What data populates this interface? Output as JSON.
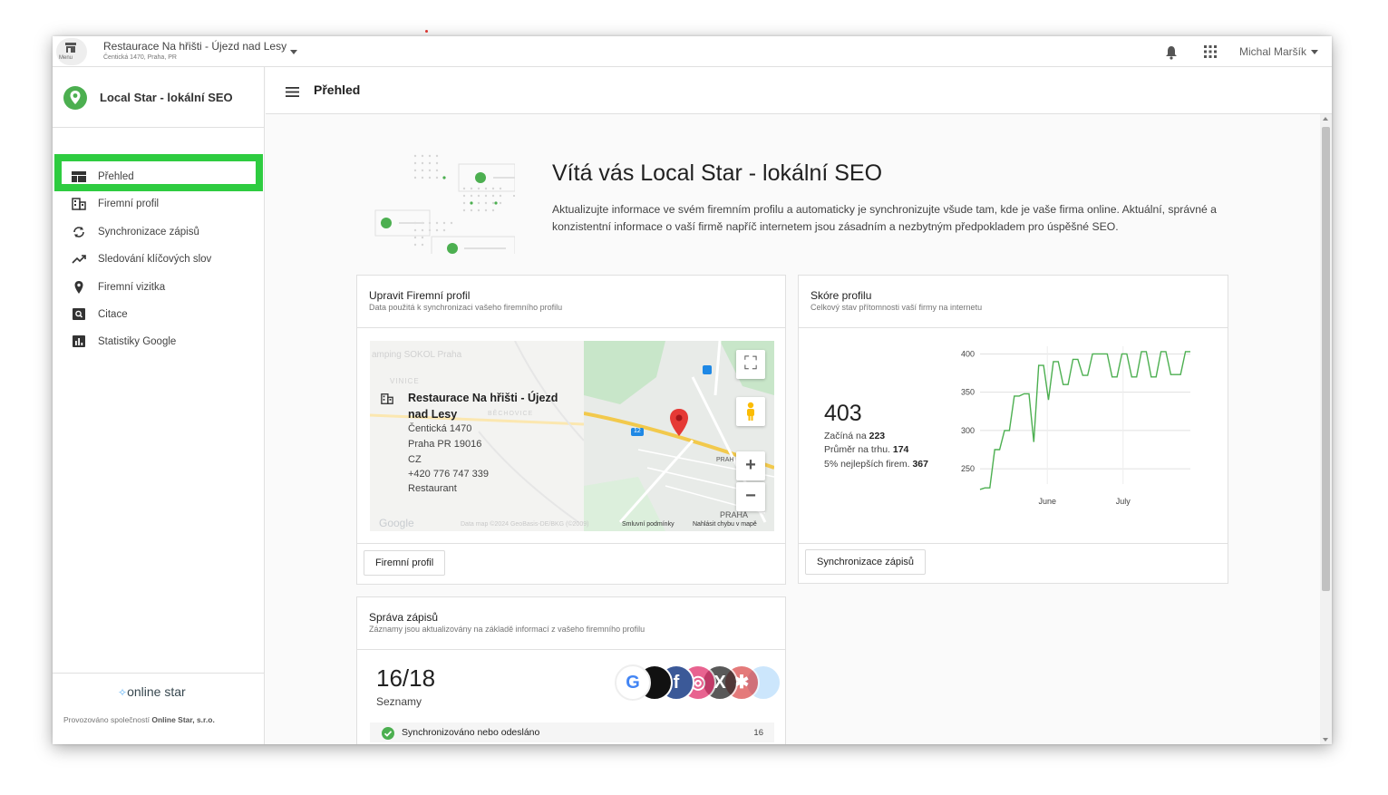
{
  "topbar": {
    "menu_label": "Menu",
    "business_name": "Restaurace Na hřišti - Újezd nad Lesy",
    "business_address": "Čentická 1470, Praha, PR",
    "user_name": "Michal Maršík"
  },
  "sidebar": {
    "brand_title": "Local Star - lokální SEO",
    "items": [
      {
        "label": "Přehled",
        "icon": "dashboard-icon"
      },
      {
        "label": "Firemní profil",
        "icon": "building-icon"
      },
      {
        "label": "Synchronizace zápisů",
        "icon": "sync-icon"
      },
      {
        "label": "Sledování klíčových slov",
        "icon": "trending-up-icon"
      },
      {
        "label": "Firemní vizitka",
        "icon": "location-pin-icon"
      },
      {
        "label": "Citace",
        "icon": "search-box-icon"
      },
      {
        "label": "Statistiky Google",
        "icon": "bar-chart-icon"
      }
    ],
    "footer_logo": "online star",
    "footer_text_prefix": "Provozováno společností",
    "footer_company": "Online Star, s.r.o."
  },
  "header": {
    "title": "Přehled"
  },
  "welcome": {
    "title": "Vítá vás Local Star - lokální SEO",
    "text": "Aktualizujte informace ve svém firemním profilu a automaticky je synchronizujte všude tam, kde je vaše firma online. Aktuální, správné a konzistentní informace o vaší firmě napříč internetem jsou zásadním a nezbytným předpokladem pro úspěšné SEO."
  },
  "profile_card": {
    "title": "Upravit Firemní profil",
    "subtitle": "Data použitá k synchronizaci vašeho firemního profilu",
    "business": {
      "name": "Restaurace Na hřišti - Újezd nad Lesy",
      "street": "Čentická 1470",
      "city": "Praha PR 19016",
      "country": "CZ",
      "phone": "+420 776 747 339",
      "category": "Restaurant"
    },
    "map": {
      "faded_label_1": "amping SOKOL Praha",
      "faded_label_2": "VINICE",
      "faded_label_3": "BĚCHOVICE",
      "road_badge": "12",
      "area_label": "PRAH",
      "area_label_2": "PRAHA",
      "google_logo": "Google",
      "map_data": "Data map ©2024 GeoBasis-DE/BKG (©2009)",
      "terms": "Smluvní podmínky",
      "report": "Nahlásit chybu v mapě"
    },
    "button": "Firemní profil"
  },
  "score_card": {
    "title": "Skóre profilu",
    "subtitle": "Celkový stav přítomnosti vaší firmy na internetu",
    "score": "403",
    "start_label": "Začíná na",
    "start_value": "223",
    "avg_label": "Průměr na trhu.",
    "avg_value": "174",
    "top_label": "5% nejlepších firem.",
    "top_value": "367",
    "button": "Synchronizace zápisů"
  },
  "chart_data": {
    "type": "line",
    "title": "",
    "xlabel": "",
    "ylabel": "",
    "ylim": [
      230,
      410
    ],
    "yticks": [
      250,
      300,
      350,
      400
    ],
    "xticks": [
      "June",
      "July"
    ],
    "grid": true,
    "color": "#4caf50",
    "series": [
      {
        "values": [
          223,
          225,
          225,
          275,
          275,
          300,
          300,
          345,
          345,
          348,
          348,
          285,
          385,
          385,
          340,
          390,
          390,
          360,
          360,
          393,
          393,
          372,
          372,
          400,
          400,
          400,
          400,
          370,
          370,
          400,
          400,
          370,
          370,
          403,
          403,
          370,
          370,
          403,
          403,
          373,
          373,
          373,
          403,
          403
        ]
      }
    ]
  },
  "listings_card": {
    "title": "Správa zápisů",
    "subtitle": "Záznamy jsou aktualizovány na základě informací z vašeho firemního profilu",
    "count": "16/18",
    "count_label": "Seznamy",
    "logos": [
      {
        "icon": "google-icon",
        "letter": "G",
        "color": "#ffffff"
      },
      {
        "icon": "apple-icon",
        "letter": "",
        "color": "#111111"
      },
      {
        "icon": "facebook-icon",
        "letter": "f",
        "color": "#3b5998"
      },
      {
        "icon": "instagram-icon",
        "letter": "◎",
        "color": "#e1306c"
      },
      {
        "icon": "x-icon",
        "letter": "X",
        "color": "#222222"
      },
      {
        "icon": "yelp-icon",
        "letter": "✱",
        "color": "#d32323"
      },
      {
        "icon": "other-service-icon",
        "letter": "",
        "color": "#90caf9"
      }
    ],
    "sync_row_label": "Synchronizováno nebo odesláno",
    "sync_row_count": "16"
  },
  "colors": {
    "accent": "#2ecc40",
    "brand_green": "#4caf50",
    "map_pin": "#e53935"
  }
}
